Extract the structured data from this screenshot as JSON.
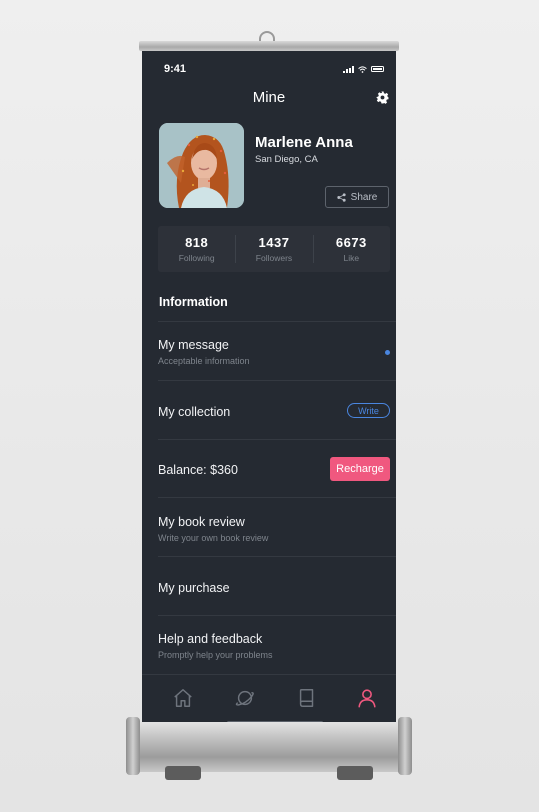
{
  "status_bar": {
    "time": "9:41"
  },
  "header": {
    "title": "Mine"
  },
  "profile": {
    "name": "Marlene Anna",
    "location": "San Diego, CA",
    "share_label": "Share"
  },
  "stats": [
    {
      "value": "818",
      "label": "Following"
    },
    {
      "value": "1437",
      "label": "Followers"
    },
    {
      "value": "6673",
      "label": "Like"
    }
  ],
  "section_title": "Information",
  "menu": {
    "message": {
      "label": "My message",
      "sub": "Acceptable information"
    },
    "collection": {
      "label": "My collection",
      "action": "Write"
    },
    "balance": {
      "label": "Balance: $360",
      "action": "Recharge"
    },
    "book_review": {
      "label": "My book review",
      "sub": "Write your own book review"
    },
    "purchase": {
      "label": "My purchase"
    },
    "help": {
      "label": "Help and feedback",
      "sub": "Promptly help your problems"
    }
  },
  "tabs": [
    {
      "icon": "home-icon"
    },
    {
      "icon": "discover-planet-icon"
    },
    {
      "icon": "book-icon"
    },
    {
      "icon": "profile-icon",
      "active": true
    }
  ],
  "colors": {
    "background": "#252a32",
    "accent_blue": "#4a86e0",
    "accent_pink": "#f0587f"
  }
}
